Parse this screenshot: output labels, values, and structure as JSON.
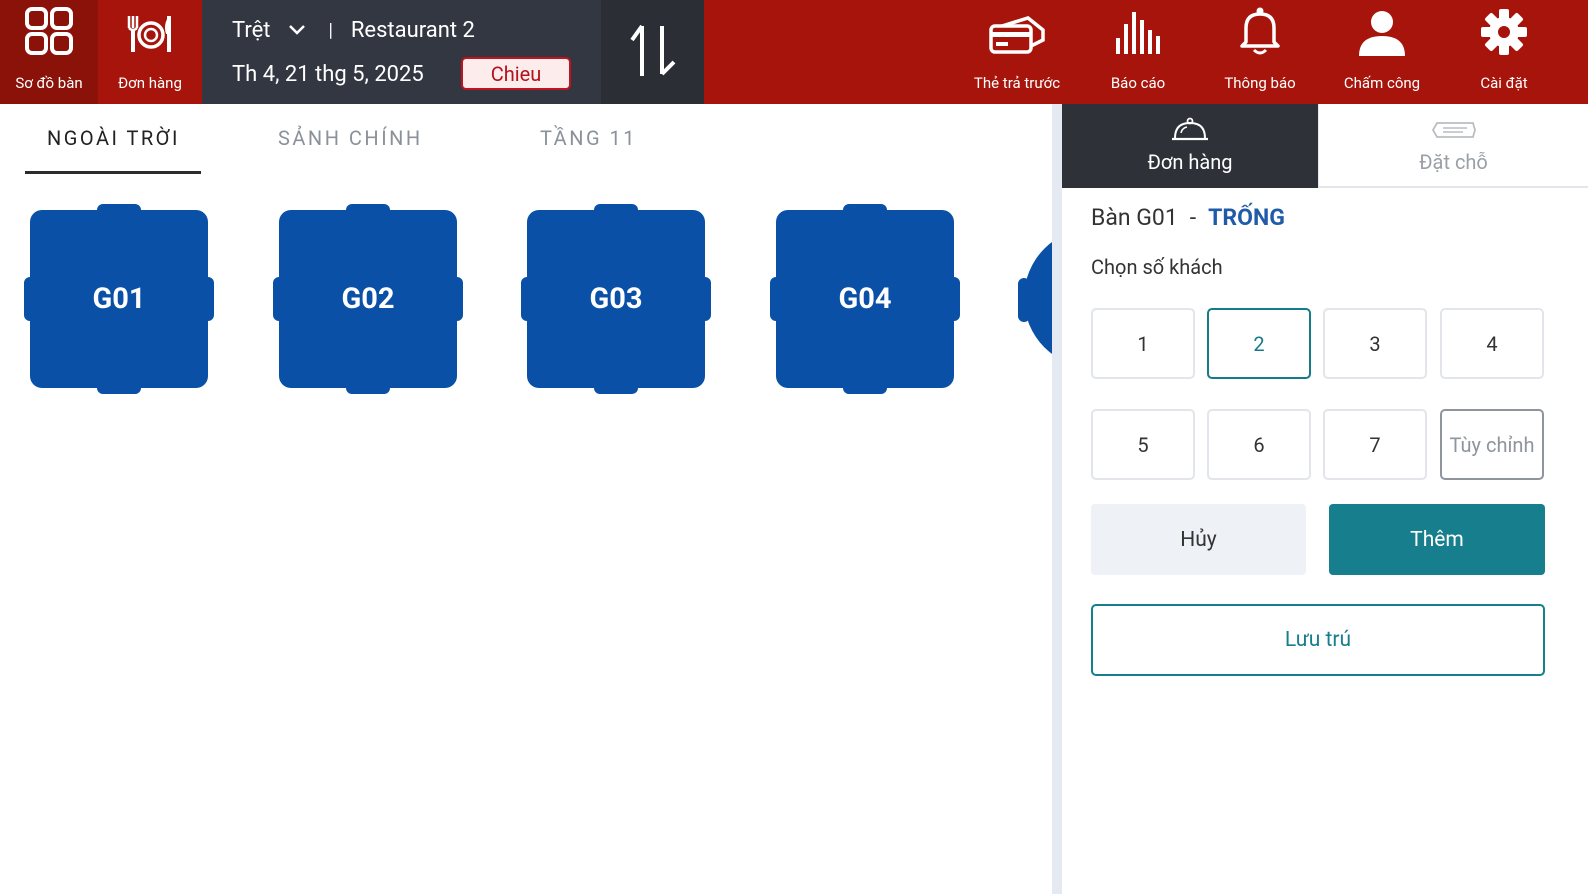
{
  "topbar": {
    "nav_map": {
      "label": "Sơ đồ bàn",
      "icon": "grid-icon"
    },
    "nav_orders": {
      "label": "Đơn hàng",
      "icon": "plate-cutlery-icon"
    },
    "floor_name": "Trệt",
    "restaurant_name": "Restaurant 2",
    "date": "Th 4, 21 thg 5, 2025",
    "shift": "Chieu",
    "nav_prepaid": {
      "label": "Thẻ trả trước",
      "icon": "card-icon"
    },
    "nav_report": {
      "label": "Báo cáo",
      "icon": "bar-chart-icon"
    },
    "nav_notice": {
      "label": "Thông báo",
      "icon": "bell-icon"
    },
    "nav_attend": {
      "label": "Chấm công",
      "icon": "user-icon"
    },
    "nav_settings": {
      "label": "Cài đặt",
      "icon": "gear-icon"
    }
  },
  "tabs": [
    {
      "label": "NGOÀI TRỜI",
      "active": true
    },
    {
      "label": "SẢNH CHÍNH",
      "active": false
    },
    {
      "label": "TẦNG 11",
      "active": false
    }
  ],
  "tables": [
    {
      "name": "G01"
    },
    {
      "name": "G02"
    },
    {
      "name": "G03"
    },
    {
      "name": "G04"
    }
  ],
  "panel": {
    "tab_orders": "Đơn hàng",
    "tab_booking": "Đặt chỗ",
    "table_label": "Bàn G01",
    "table_dash": "-",
    "table_state": "TRỐNG",
    "guest_label": "Chọn số khách",
    "guest_options": [
      "1",
      "2",
      "3",
      "4",
      "5",
      "6",
      "7",
      "Tùy chỉnh"
    ],
    "selected_guests": "2",
    "cancel_label": "Hủy",
    "add_label": "Thêm",
    "stay_label": "Lưu trú"
  },
  "colors": {
    "topbar": "#a7140b",
    "table": "#0a50a6",
    "accent": "#167e8c",
    "status": "#1f5ba8"
  }
}
